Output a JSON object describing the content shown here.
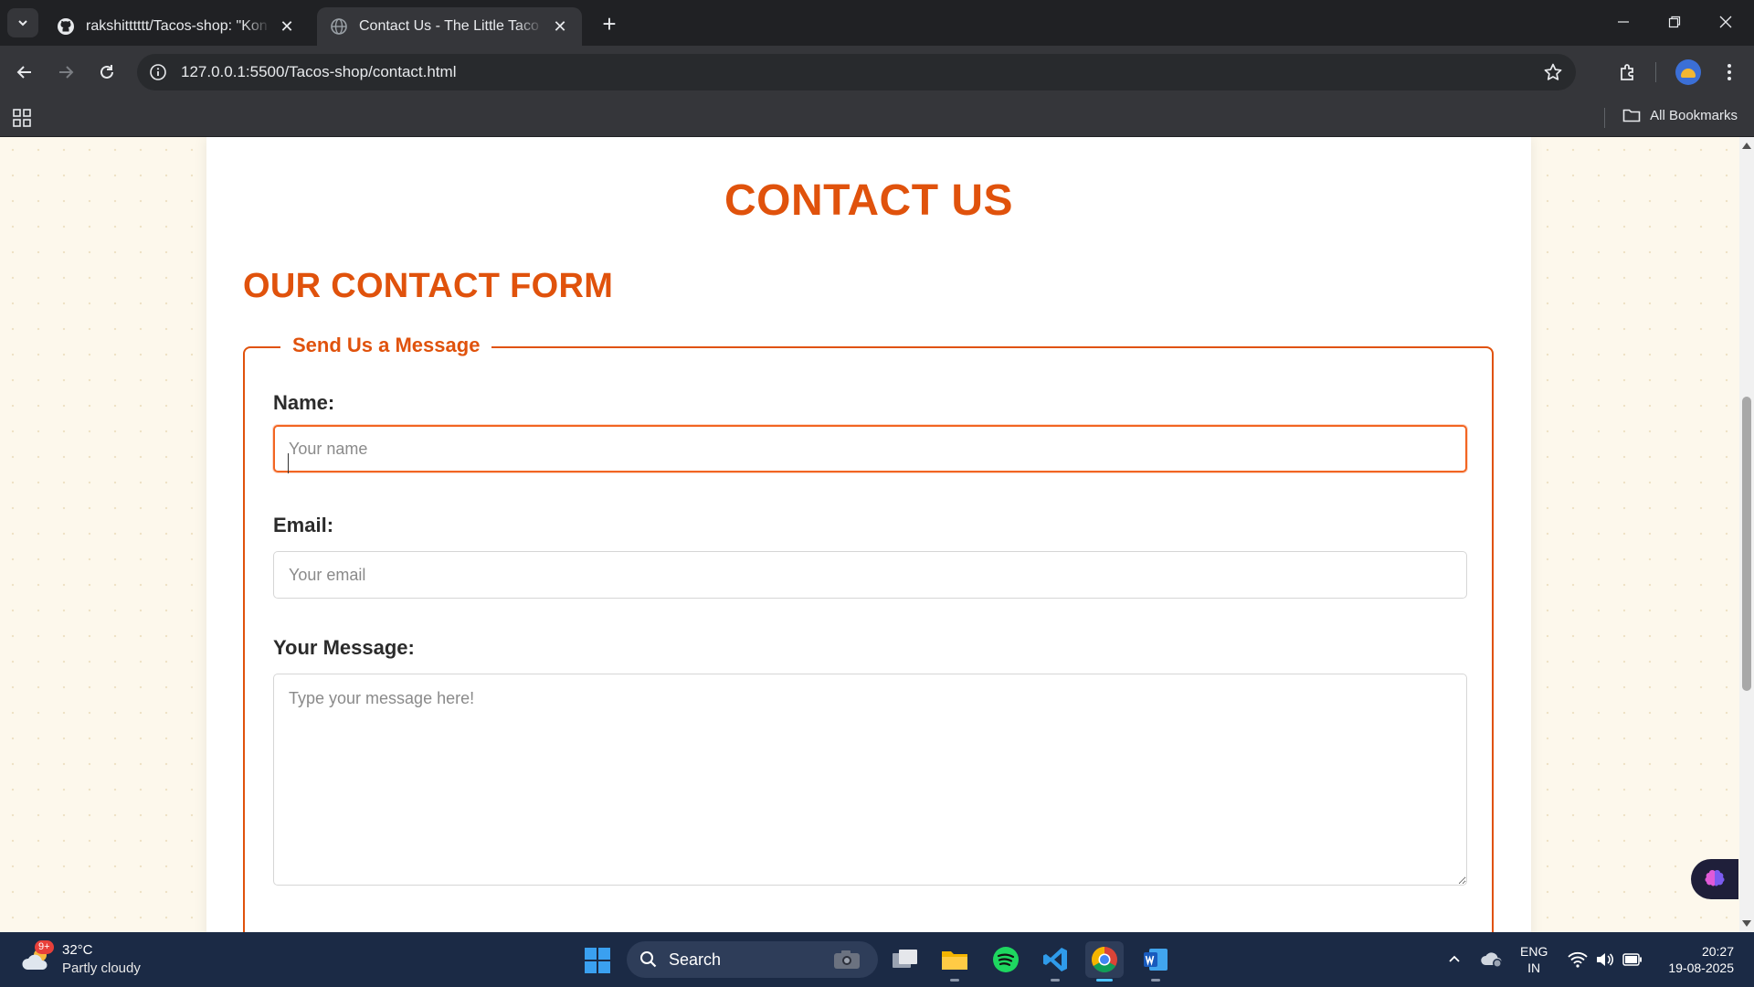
{
  "browser": {
    "tabs": [
      {
        "title": "rakshitttttt/Tacos-shop: \"Kon hai",
        "favicon": "github-icon",
        "active": false
      },
      {
        "title": "Contact Us - The Little Taco Shop",
        "favicon": "globe-icon",
        "active": true
      }
    ],
    "url": "127.0.0.1:5500/Tacos-shop/contact.html",
    "bookmarks_label": "All Bookmarks"
  },
  "page": {
    "title": "CONTACT US",
    "section_title": "OUR CONTACT FORM",
    "form": {
      "legend": "Send Us a Message",
      "name_label": "Name:",
      "name_placeholder": "Your name",
      "email_label": "Email:",
      "email_placeholder": "Your email",
      "message_label": "Your Message:",
      "message_placeholder": "Type your message here!"
    },
    "colors": {
      "accent": "#e0520c",
      "focus": "#f26522",
      "background": "#fdf8ec"
    }
  },
  "taskbar": {
    "weather": {
      "temp": "32°C",
      "condition": "Partly cloudy",
      "badge": "9+"
    },
    "search_label": "Search",
    "language": {
      "line1": "ENG",
      "line2": "IN"
    },
    "clock": {
      "time": "20:27",
      "date": "19-08-2025"
    },
    "apps": [
      "task-view",
      "file-explorer",
      "spotify",
      "vs-code",
      "chrome",
      "word"
    ]
  }
}
